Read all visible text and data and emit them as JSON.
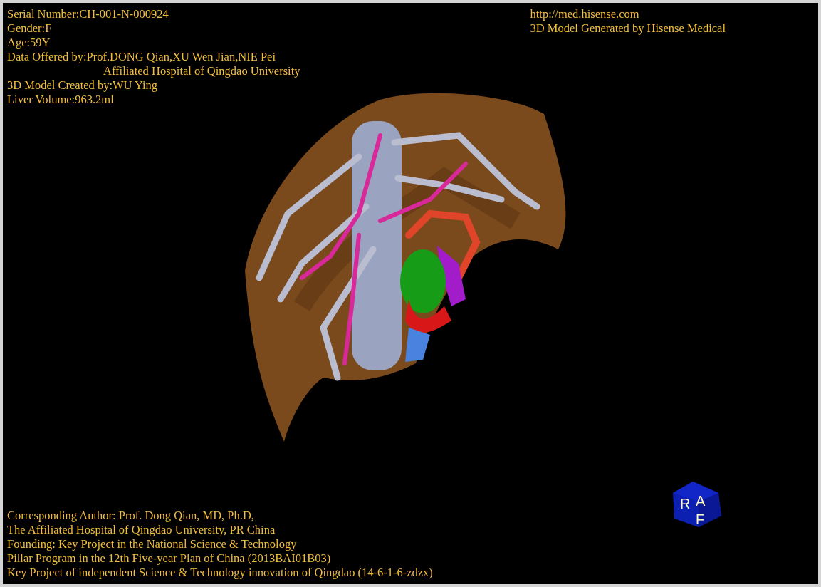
{
  "info_lines": [
    {
      "kind": "line",
      "text": "Serial Number:CH-001-N-000924"
    },
    {
      "kind": "line",
      "text": "Gender:F"
    },
    {
      "kind": "line",
      "text": "Age:59Y"
    },
    {
      "kind": "line",
      "text": "Data Offered by:Prof.DONG Qian,XU Wen Jian,NIE Pei"
    },
    {
      "kind": "continuation",
      "text": "Affiliated Hospital of Qingdao University"
    },
    {
      "kind": "line",
      "text": "3D Model Created by:WU Ying"
    },
    {
      "kind": "line",
      "text": "Liver Volume:963.2ml"
    }
  ],
  "brand_lines": [
    "http://med.hisense.com",
    "3D Model Generated by Hisense Medical"
  ],
  "credit_lines": [
    "Corresponding Author: Prof. Dong Qian, MD, Ph.D,",
    "The Affiliated Hospital of Qingdao University, PR China",
    "Founding: Key Project in the National Science & Technology",
    "Pillar Program in the 12th Five-year Plan of China (2013BAI01B03)",
    "Key Project of independent Science & Technology innovation of Qingdao (14-6-1-6-zdzx)"
  ],
  "orientation_cube": {
    "labels": [
      "R",
      "A",
      "F"
    ]
  }
}
